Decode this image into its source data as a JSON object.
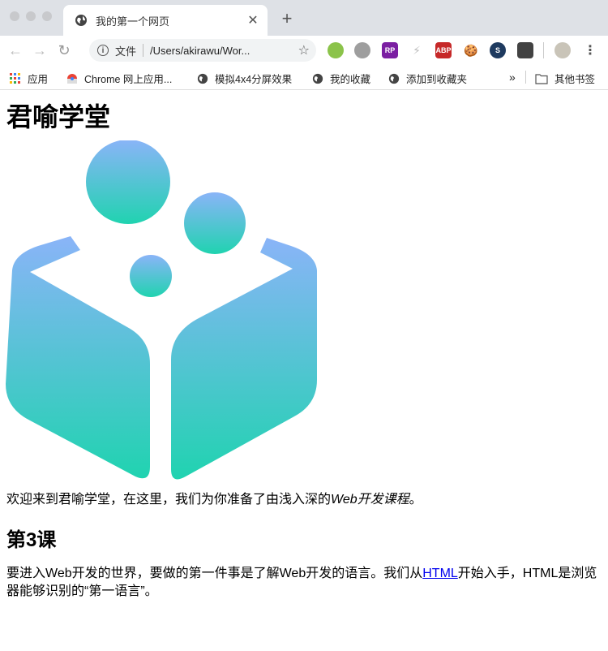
{
  "browser": {
    "tab_title": "我的第一个网页",
    "tab_close": "✕",
    "new_tab": "+",
    "address": {
      "scheme_label": "文件",
      "url": "/Users/akirawu/Wor..."
    },
    "extensions": [
      {
        "name": "green-dot-extension-icon",
        "label": "",
        "color": "#8bc34a"
      },
      {
        "name": "grey-circle-extension-icon",
        "label": "",
        "color": "#9e9e9e"
      },
      {
        "name": "rp-extension-icon",
        "label": "RP",
        "color": "#7b1fa2"
      },
      {
        "name": "lightning-extension-icon",
        "label": "⚡",
        "color": "#bdbdbd"
      },
      {
        "name": "abp-extension-icon",
        "label": "ABP",
        "color": "#c62828"
      },
      {
        "name": "cookie-extension-icon",
        "label": "🍪",
        "color": "#d9a441"
      },
      {
        "name": "s-extension-icon",
        "label": "S",
        "color": "#1e3a5f"
      },
      {
        "name": "shield-extension-icon",
        "label": "",
        "color": "#424242"
      }
    ]
  },
  "bookmarks": {
    "apps": "应用",
    "items": [
      "Chrome 网上应用...",
      "模拟4x4分屏效果",
      "我的收藏",
      "添加到收藏夹"
    ],
    "overflow": "»",
    "other": "其他书签"
  },
  "page": {
    "heading": "君喻学堂",
    "intro_before": "欢迎来到君喻学堂，在这里，我们为你准备了由浅入深的",
    "intro_em": "Web开发课程",
    "intro_after": "。",
    "lesson_title": "第3课",
    "body_before": "要进入Web开发的世界，要做的第一件事是了解Web开发的语言。我们从",
    "body_link": "HTML",
    "body_after": "开始入手，HTML是浏览器能够识别的“第一语言”。"
  },
  "colors": {
    "logo_top": "#8ab4f8",
    "logo_bottom": "#20d3b0",
    "link": "#0000ee"
  }
}
